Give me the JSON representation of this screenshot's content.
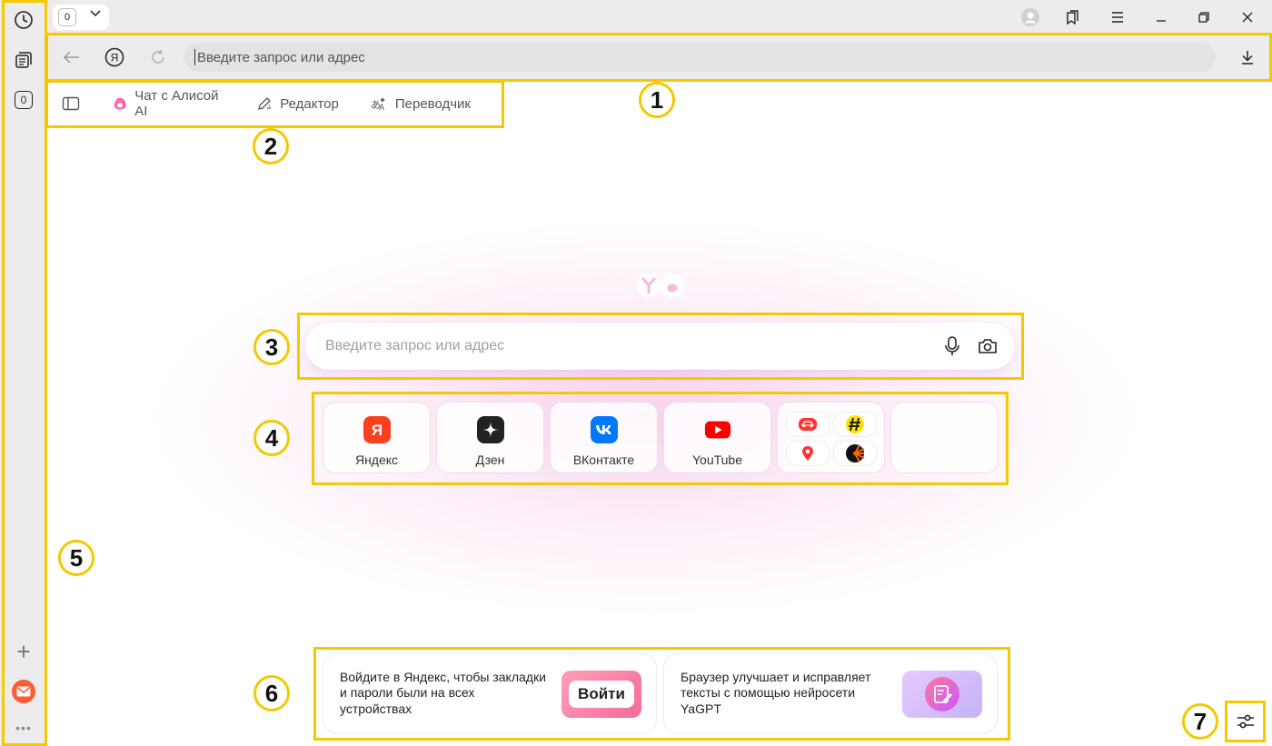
{
  "sidebar": {
    "history_icon": "clock-icon",
    "collections_icon": "cards-icon",
    "tab_count": "0",
    "add_icon": "plus-icon",
    "mail_icon": "mail-icon",
    "more_icon": "dots-icon"
  },
  "tabbar": {
    "tab_count": "0"
  },
  "addressbar": {
    "placeholder": "Введите запрос или адрес"
  },
  "bookmarks": {
    "items": [
      {
        "label": "Чат с Алисой AI",
        "icon": "alice-icon"
      },
      {
        "label": "Редактор",
        "icon": "pen-icon"
      },
      {
        "label": "Переводчик",
        "icon": "translate-icon"
      }
    ]
  },
  "search": {
    "placeholder": "Введите запрос или адрес"
  },
  "tiles": [
    {
      "label": "Яндекс",
      "icon": "yandex-icon",
      "color": "#fc3f1d"
    },
    {
      "label": "Дзен",
      "icon": "dzen-icon",
      "color": "#222222"
    },
    {
      "label": "ВКонтакте",
      "icon": "vk-icon",
      "color": "#0077ff"
    },
    {
      "label": "YouTube",
      "icon": "youtube-icon",
      "color": "#ff0000"
    }
  ],
  "promos": [
    {
      "text": "Войдите в Яндекс, чтобы закладки и пароли были на всех устройствах",
      "button": "Войти"
    },
    {
      "text": "Браузер улучшает и исправляет тексты с помощью нейросети YaGPT"
    }
  ],
  "annotations": [
    "1",
    "2",
    "3",
    "4",
    "5",
    "6",
    "7"
  ],
  "colors": {
    "annotation": "#f5c800",
    "chrome_bg": "#ececec",
    "accent_pink": "#f0aadc"
  }
}
